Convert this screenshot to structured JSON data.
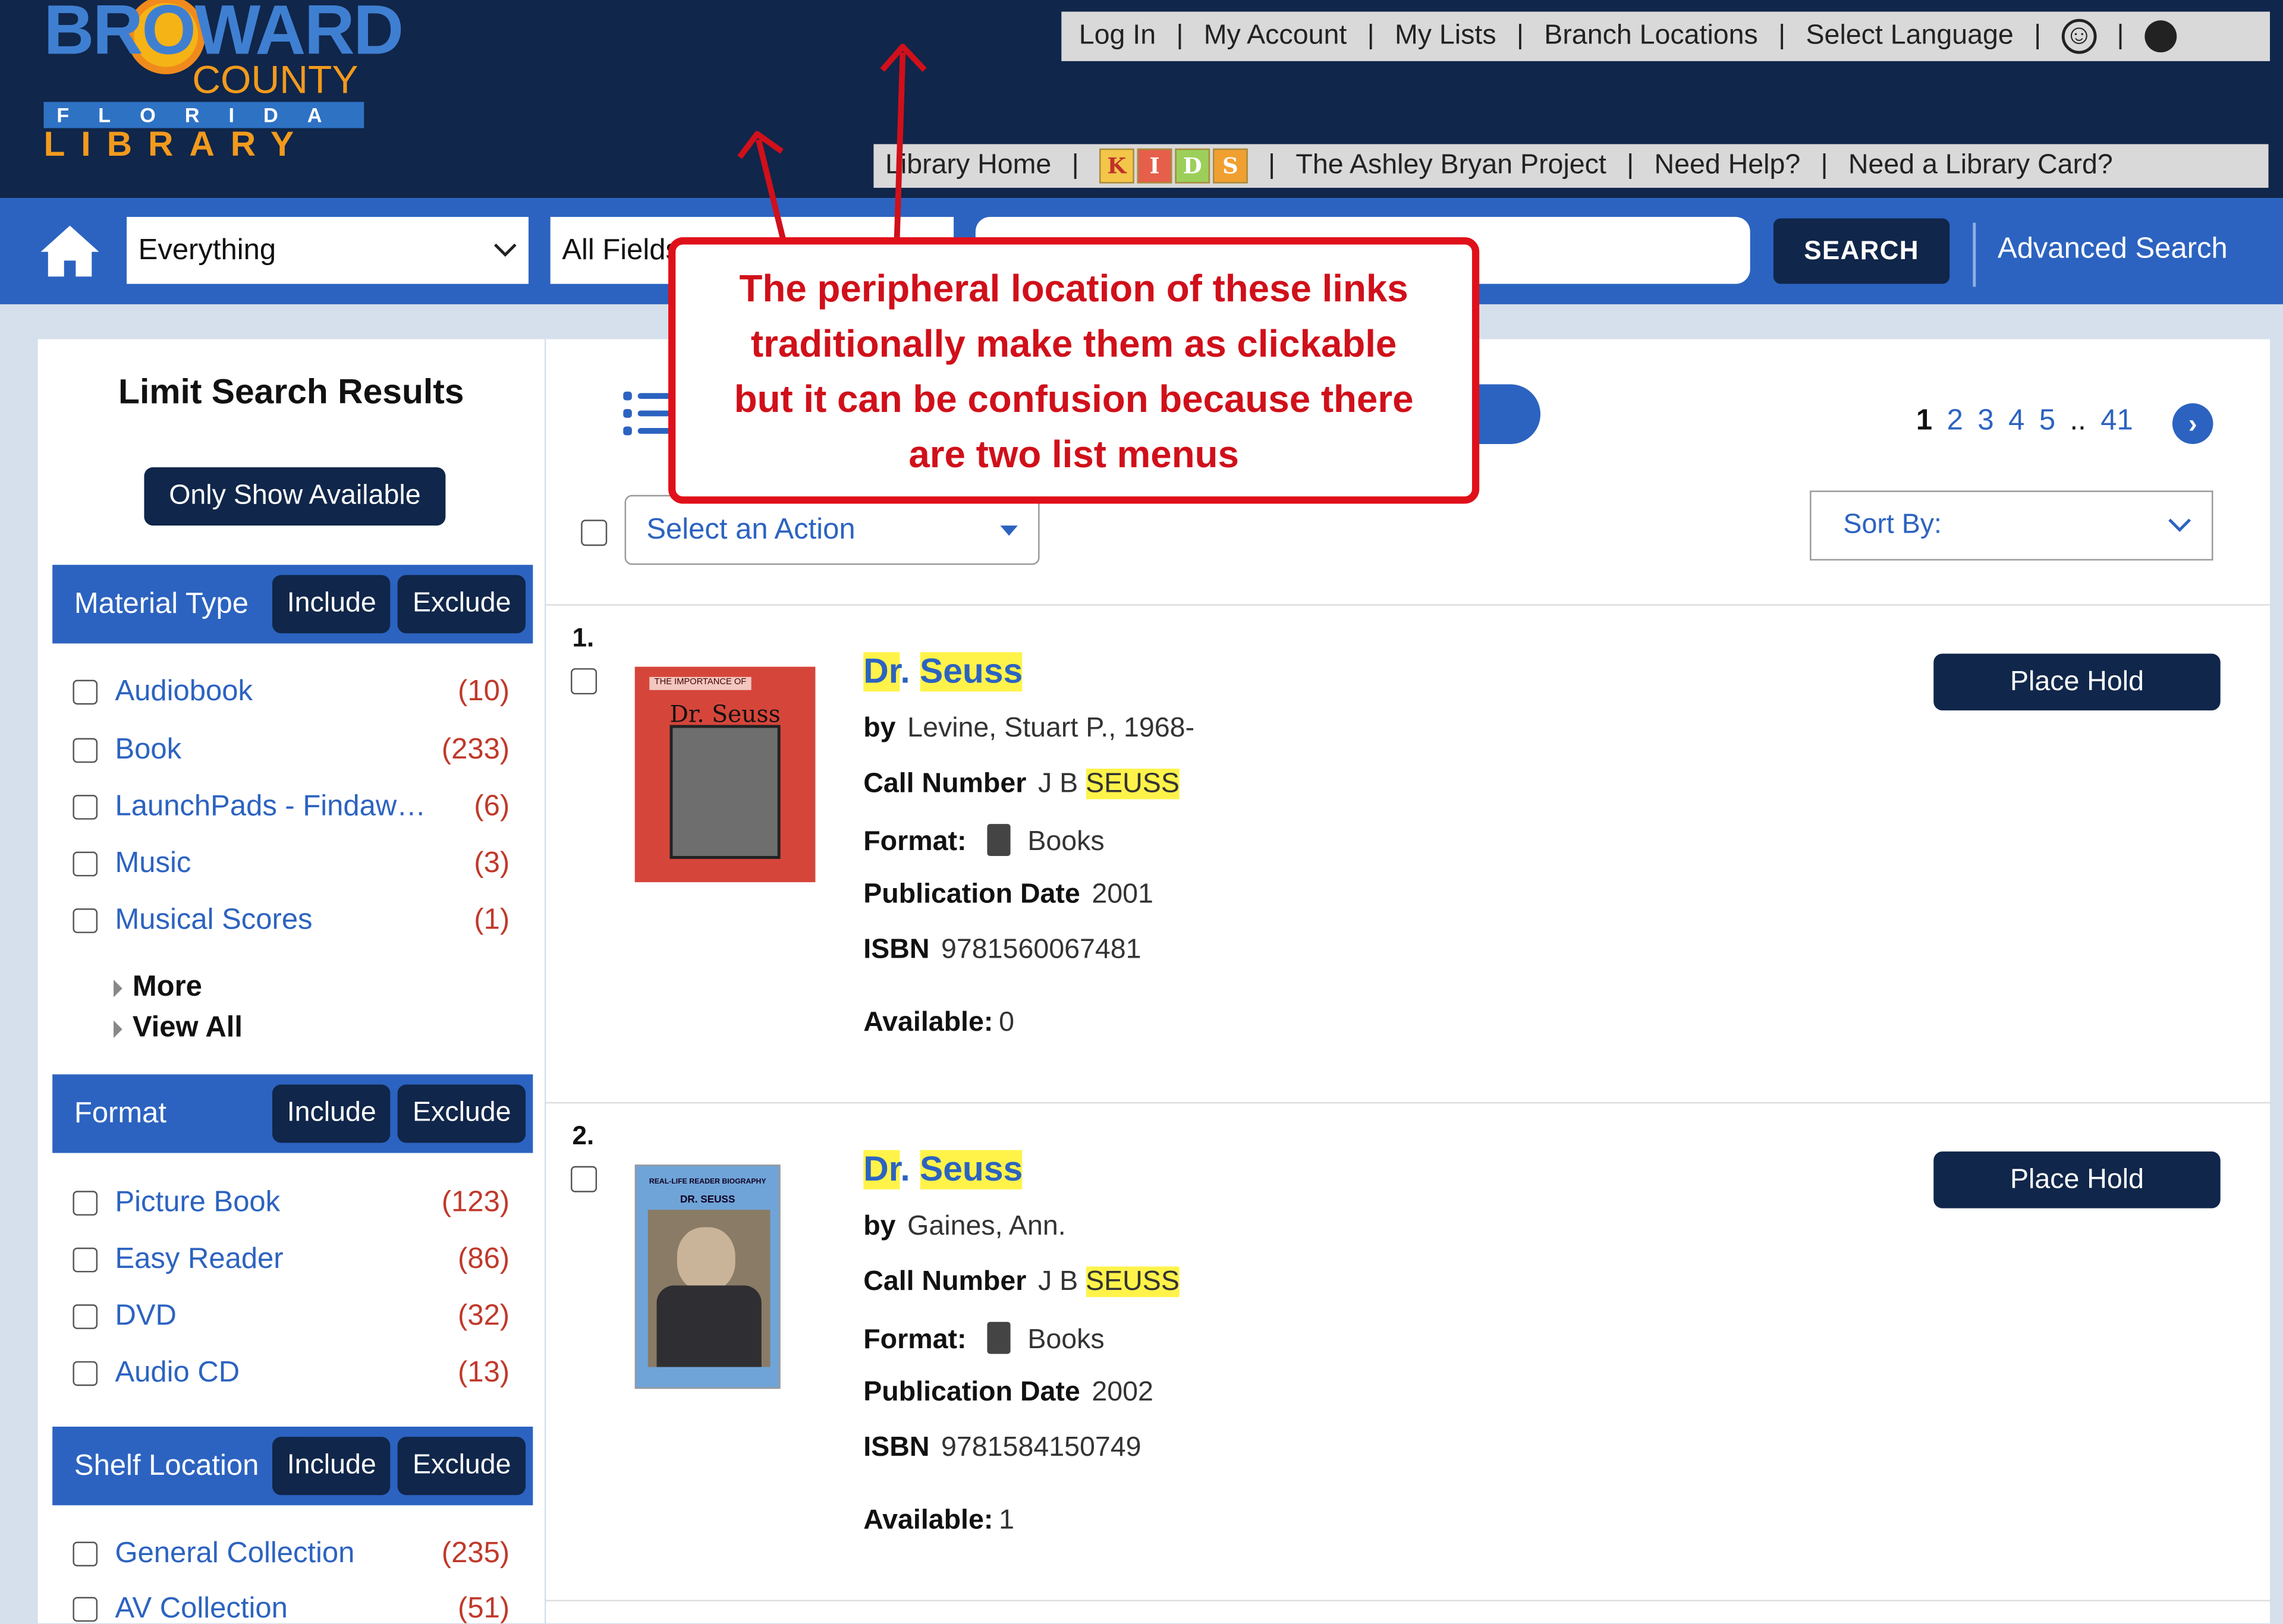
{
  "logo": {
    "broward": "BROWARD",
    "county": "COUNTY",
    "florida": "FLORIDA",
    "library": "LIBRARY"
  },
  "topnav": [
    "Log In",
    "My Account",
    "My Lists",
    "Branch Locations",
    "Select Language"
  ],
  "topnav_icons": [
    "accessibility-icon",
    "help-icon"
  ],
  "subnav": {
    "library_home": "Library Home",
    "kids": [
      "K",
      "I",
      "D",
      "S"
    ],
    "ashley": "The Ashley Bryan Project",
    "need_help": "Need Help?",
    "library_card": "Need a Library Card?"
  },
  "search": {
    "scope": "Everything",
    "field": "All Fields",
    "query": "",
    "button": "SEARCH",
    "advanced": "Advanced Search"
  },
  "sidebar": {
    "title": "Limit Search Results",
    "only_available": "Only Show Available",
    "include": "Include",
    "exclude": "Exclude",
    "material_type": {
      "title": "Material Type",
      "items": [
        {
          "label": "Audiobook",
          "count": "(10)"
        },
        {
          "label": "Book",
          "count": "(233)"
        },
        {
          "label": "LaunchPads - Findaw…",
          "count": "(6)"
        },
        {
          "label": "Music",
          "count": "(3)"
        },
        {
          "label": "Musical Scores",
          "count": "(1)"
        }
      ],
      "more": "More",
      "view_all": "View All"
    },
    "format": {
      "title": "Format",
      "items": [
        {
          "label": "Picture Book",
          "count": "(123)"
        },
        {
          "label": "Easy Reader",
          "count": "(86)"
        },
        {
          "label": "DVD",
          "count": "(32)"
        },
        {
          "label": "Audio CD",
          "count": "(13)"
        }
      ]
    },
    "shelf_location": {
      "title": "Shelf Location",
      "items": [
        {
          "label": "General Collection",
          "count": "(235)"
        },
        {
          "label": "AV Collection",
          "count": "(51)"
        }
      ]
    }
  },
  "toolbar": {
    "action_placeholder": "Select an Action",
    "sort_label": "Sort By:",
    "pages": [
      "1",
      "2",
      "3",
      "4",
      "5"
    ],
    "ellipsis": "..",
    "last_page": "41",
    "current_page": "1"
  },
  "labels": {
    "by": "by",
    "call_number": "Call Number",
    "format": "Format:",
    "pub_date": "Publication Date",
    "isbn": "ISBN",
    "available": "Available:",
    "place_hold": "Place Hold"
  },
  "results": [
    {
      "num": "1.",
      "title_a": "Dr",
      "title_dot": ".",
      "title_b": "Seuss",
      "author": "Levine, Stuart P., 1968-",
      "call_prefix": "J B",
      "call_hl": "SEUSS",
      "format": "Books",
      "pub_date": "2001",
      "isbn": "9781560067481",
      "available": "0",
      "cover_top": "THE IMPORTANCE OF",
      "cover_title": "Dr. Seuss"
    },
    {
      "num": "2.",
      "title_a": "Dr",
      "title_dot": ".",
      "title_b": "Seuss",
      "author": "Gaines, Ann.",
      "call_prefix": "J B",
      "call_hl": "SEUSS",
      "format": "Books",
      "pub_date": "2002",
      "isbn": "9781584150749",
      "available": "1",
      "cover_top": "REAL-LIFE READER BIOGRAPHY",
      "cover_title": "DR. SEUSS"
    }
  ],
  "annotation": {
    "lines": [
      "The peripheral location of these links",
      "traditionally make them as clickable",
      "but it can be confusion because there",
      "are two list menus"
    ],
    "color": "#d0101a"
  },
  "colors": {
    "header": "#10264a",
    "accent": "#2c63c0",
    "highlight": "#fff34a",
    "count": "#c0392b"
  }
}
